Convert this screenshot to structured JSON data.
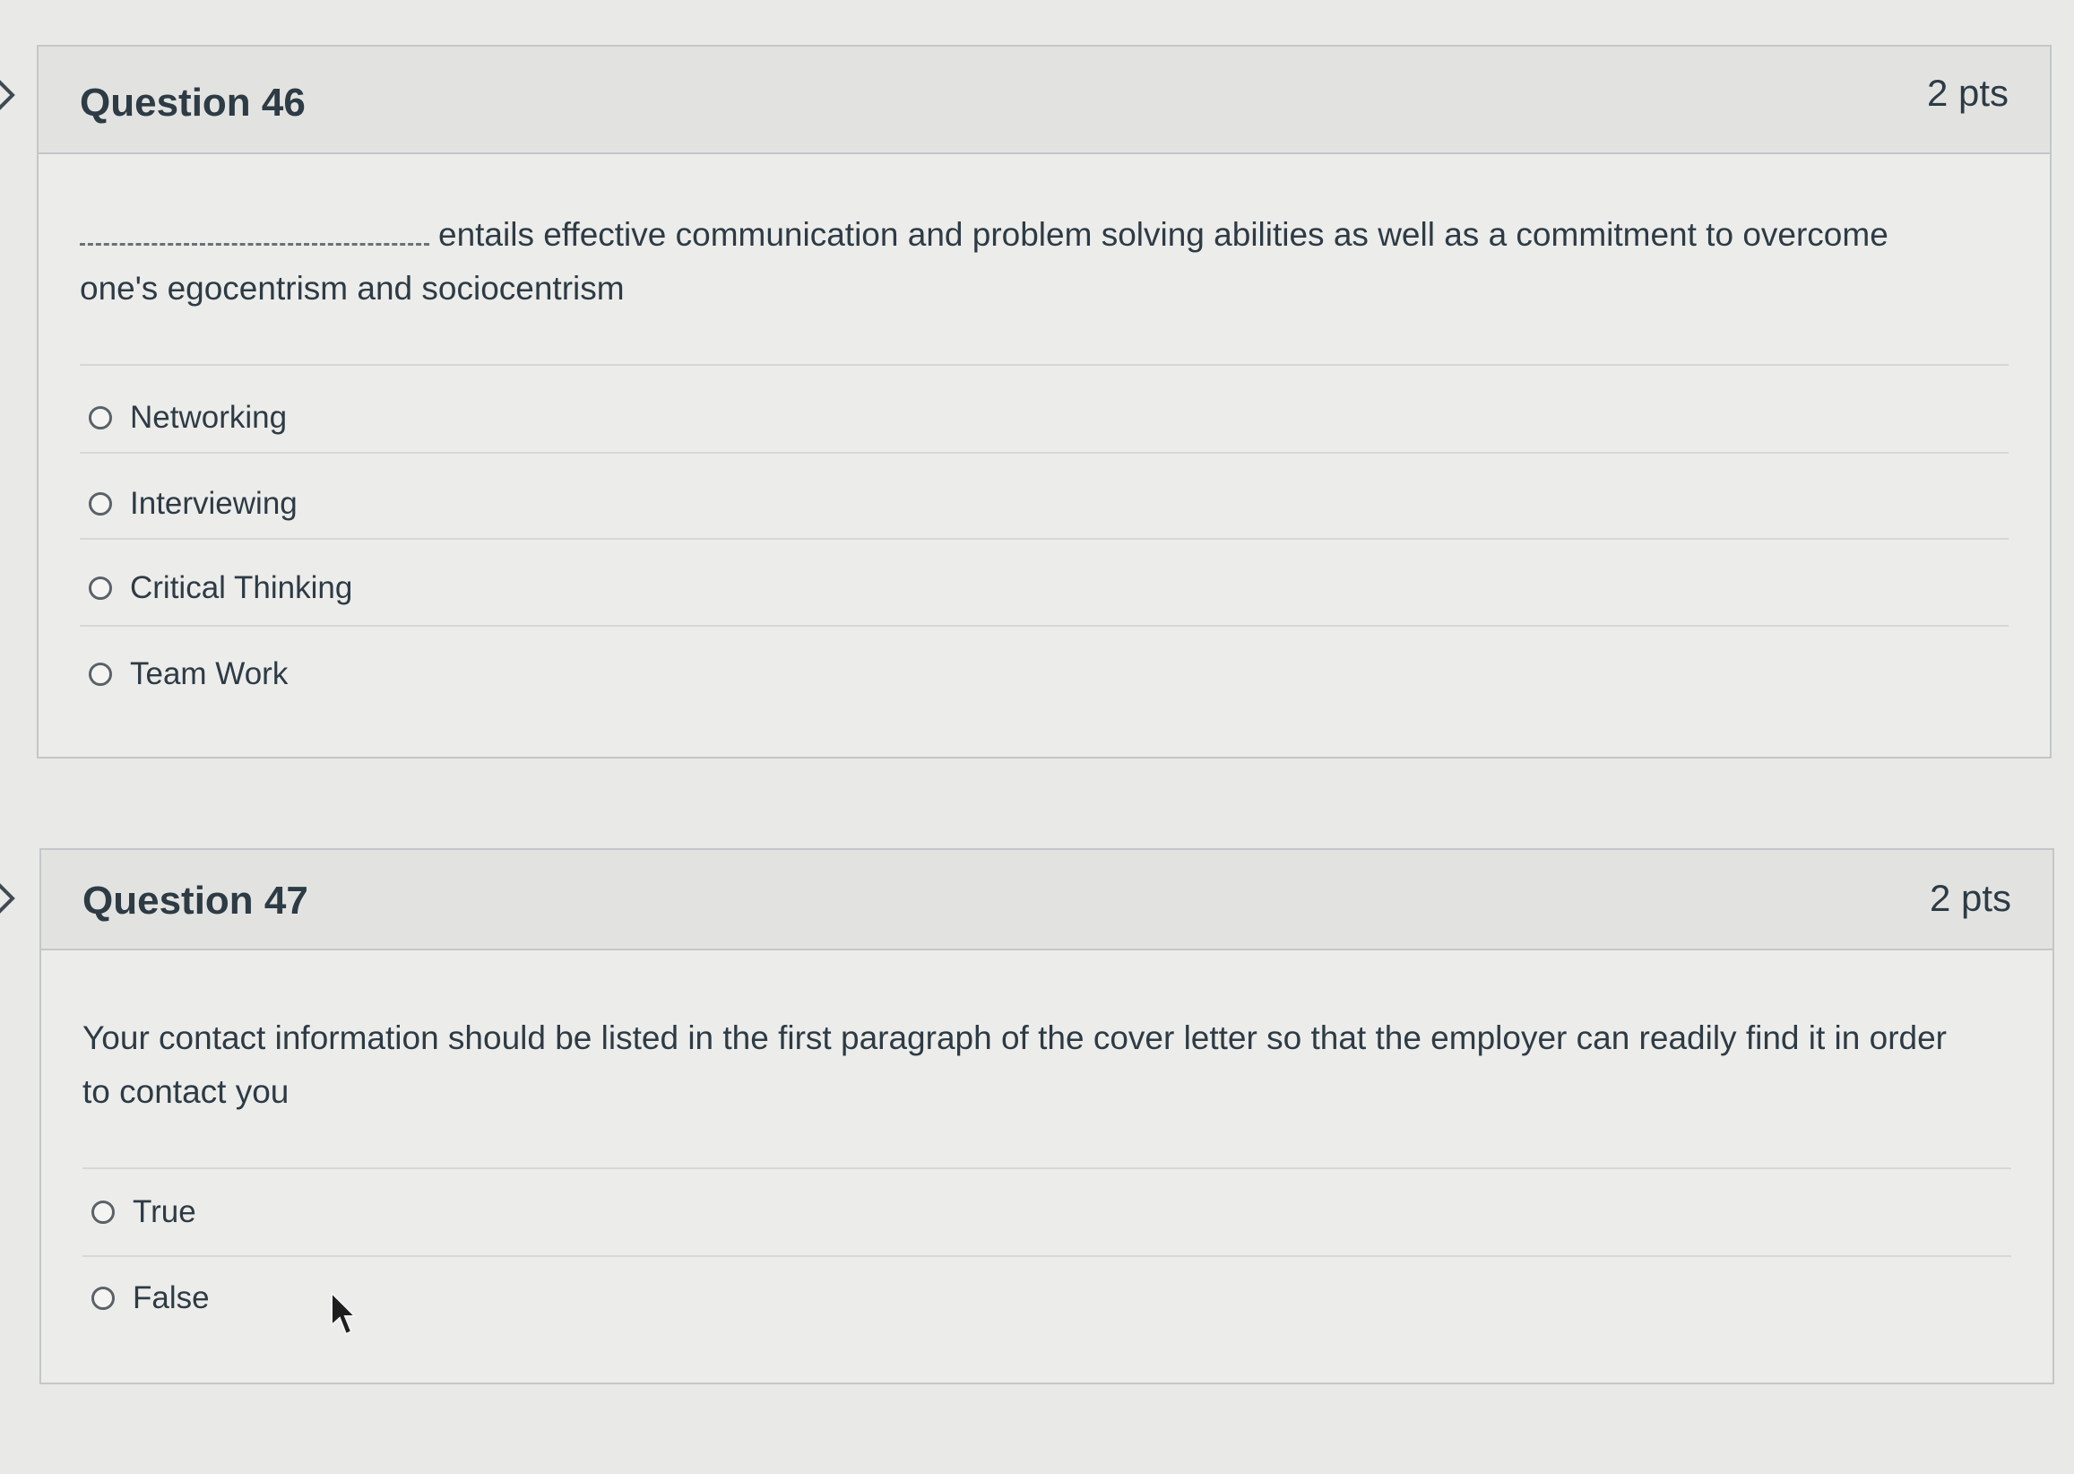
{
  "questions": [
    {
      "title": "Question 46",
      "points": "2 pts",
      "text_after_blank": "entails effective communication and problem solving abilities as well as a commitment to overcome one's egocentrism and sociocentrism",
      "answers": [
        "Networking",
        "Interviewing",
        "Critical Thinking",
        "Team Work"
      ]
    },
    {
      "title": "Question 47",
      "points": "2 pts",
      "text": "Your contact information should be listed in the first paragraph of the cover letter so that the employer can readily find it in order to contact you",
      "answers": [
        "True",
        "False"
      ]
    }
  ],
  "icons": {
    "collapse": "chevron-right-icon",
    "radio": "radio-empty-icon",
    "cursor": "mouse-pointer-icon"
  },
  "colors": {
    "text": "#2d3b45",
    "header_bg": "#e2e3e1",
    "border": "#c4c7c9"
  }
}
